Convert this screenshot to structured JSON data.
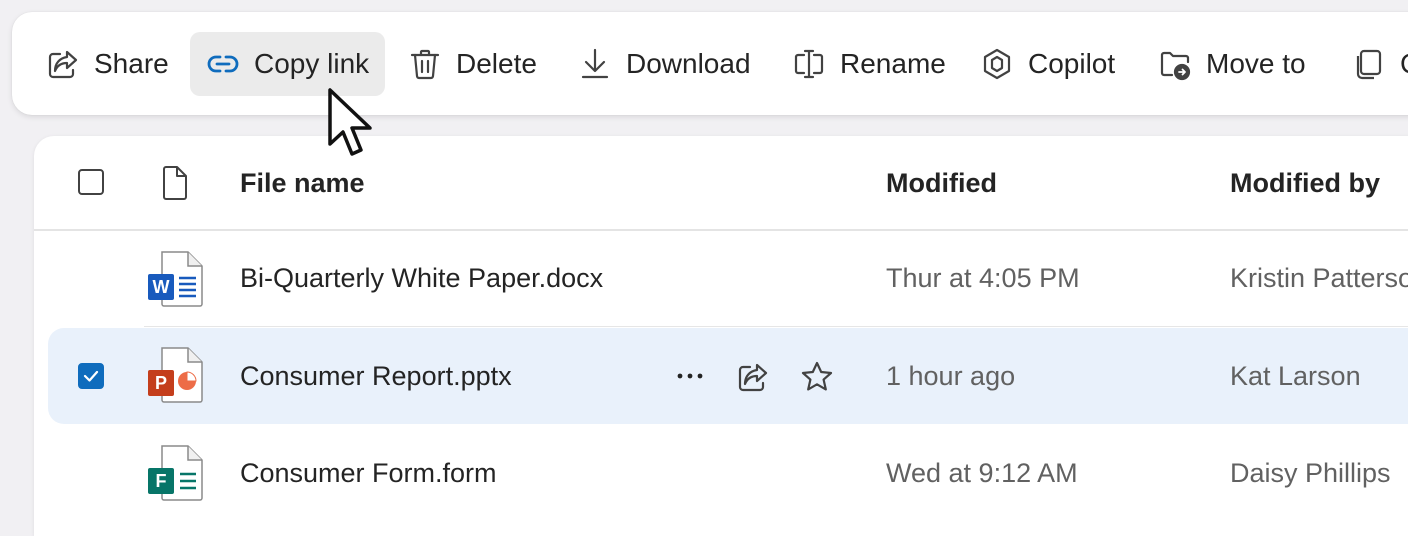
{
  "toolbar": {
    "items": [
      {
        "label": "Share",
        "icon": "share-icon"
      },
      {
        "label": "Copy link",
        "icon": "link-icon",
        "active": true
      },
      {
        "label": "Delete",
        "icon": "trash-icon"
      },
      {
        "label": "Download",
        "icon": "download-icon"
      },
      {
        "label": "Rename",
        "icon": "rename-icon"
      },
      {
        "label": "Copilot",
        "icon": "copilot-icon"
      },
      {
        "label": "Move to",
        "icon": "move-to-folder-icon"
      },
      {
        "label": "C",
        "icon": "copy-icon"
      }
    ]
  },
  "list": {
    "headers": {
      "file_name": "File name",
      "modified": "Modified",
      "modified_by": "Modified by"
    },
    "rows": [
      {
        "name": "Bi-Quarterly White Paper.docx",
        "modified": "Thur at 4:05 PM",
        "modified_by": "Kristin Patterson",
        "type": "word",
        "badge": "W",
        "selected": false
      },
      {
        "name": "Consumer Report.pptx",
        "modified": "1 hour ago",
        "modified_by": "Kat Larson",
        "type": "powerpoint",
        "badge": "P",
        "selected": true
      },
      {
        "name": "Consumer Form.form",
        "modified": "Wed at 9:12 AM",
        "modified_by": "Daisy Phillips",
        "type": "forms",
        "badge": "F",
        "selected": false
      }
    ]
  },
  "colors": {
    "accent": "#0f6cbd",
    "selected_row": "#e9f1fb",
    "word": "#185abd",
    "powerpoint": "#c43e1c",
    "forms": "#077568"
  }
}
